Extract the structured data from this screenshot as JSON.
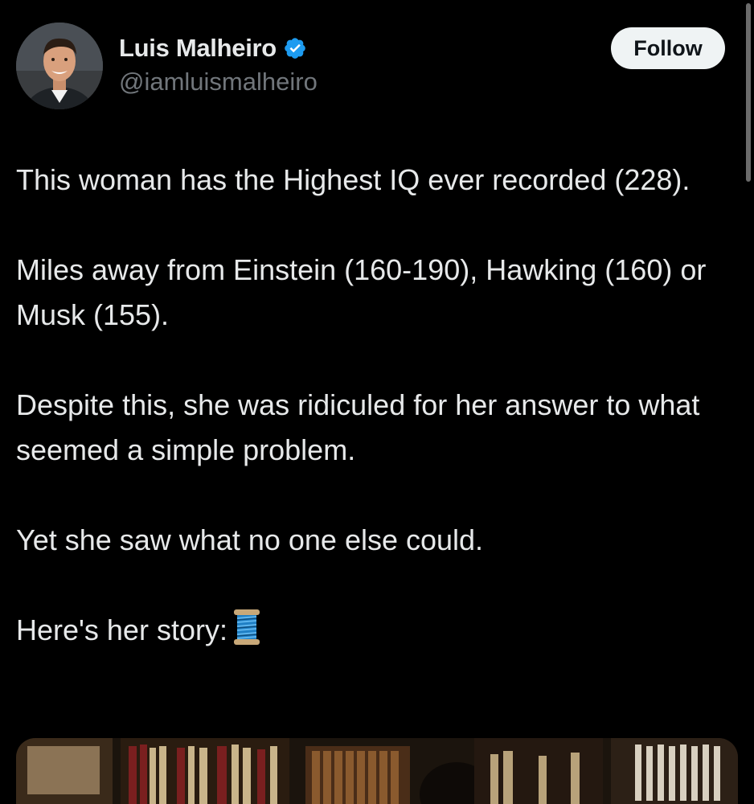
{
  "author": {
    "display_name": "Luis Malheiro",
    "handle": "@iamluismalheiro",
    "verified": true,
    "verified_icon": "verified-badge-icon"
  },
  "follow_button": {
    "label": "Follow"
  },
  "tweet": {
    "paragraphs": [
      "This woman has the Highest IQ ever recorded (228).",
      "Miles away from Einstein (160-190), Hawking (160) or Musk (155).",
      "Despite this, she was ridiculed for her answer to what seemed a simple problem.",
      "Yet she saw what no one else could.",
      "Here's her story:"
    ],
    "thread_icon": "thread-spool-icon"
  },
  "colors": {
    "background": "#000000",
    "text_primary": "#e7e9ea",
    "text_secondary": "#71767b",
    "verified_blue": "#1d9bf0",
    "follow_button_bg": "#eff3f4"
  }
}
